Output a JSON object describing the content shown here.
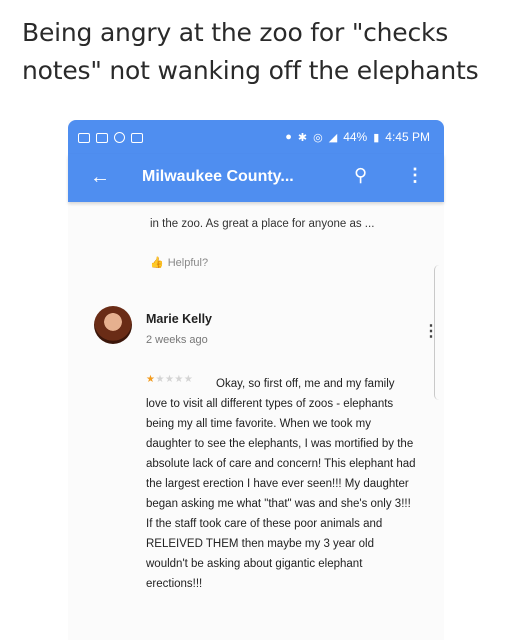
{
  "caption": "Being angry at the zoo for \"checks notes\" not wanking off the elephants",
  "statusbar": {
    "signal_text": "44%",
    "time": "4:45 PM"
  },
  "appbar": {
    "back_icon": "arrow-left-icon",
    "title": "Milwaukee County...",
    "search_icon": "search-icon",
    "more_icon": "more-vertical-icon",
    "color": "#4f8ef0"
  },
  "previous_review": {
    "text": "in the zoo. As great a place for anyone as ...",
    "helpful_label": "Helpful?"
  },
  "review": {
    "author": "Marie Kelly",
    "date": "2 weeks ago",
    "rating": 1,
    "rating_max": 5,
    "star_color": "#f39c1f",
    "text": "Okay, so first off, me and my family love to visit all different types of zoos - elephants being my all time favorite. When we took my daughter to see the elephants, I was mortified by the absolute lack of care and concern! This elephant had the largest erection I have ever seen!!! My daughter began asking me what \"that\" was and she's only 3!!! If the staff took care of these poor animals and RELEIVED THEM then maybe my 3 year old wouldn't be asking about gigantic elephant erections!!!"
  }
}
